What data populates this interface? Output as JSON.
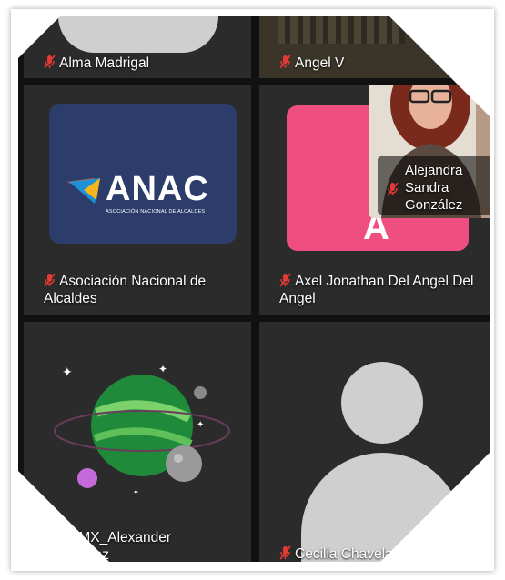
{
  "participants": [
    {
      "name": "Alma  Madrigal"
    },
    {
      "name": "Angel V"
    },
    {
      "name": "Asociación Nacional de Alcaldes"
    },
    {
      "name": "Axel Jonathan Del Angel Del Angel"
    },
    {
      "name": "CDMX_Alexander\nrnández"
    },
    {
      "name": "Cecilia Chavela"
    }
  ],
  "self_view": {
    "name": "Alejandra Sandra González"
  },
  "logo": {
    "brand": "ANAC",
    "tagline": "ASOCIACIÓN NACIONAL DE ALCALDES"
  },
  "colors": {
    "tile_bg": "#2b2b2b",
    "logo_bg": "#2c3d6b",
    "pink": "#ee4f80",
    "mic_muted": "#e53935"
  },
  "icons": {
    "muted": "mic-muted-icon"
  }
}
